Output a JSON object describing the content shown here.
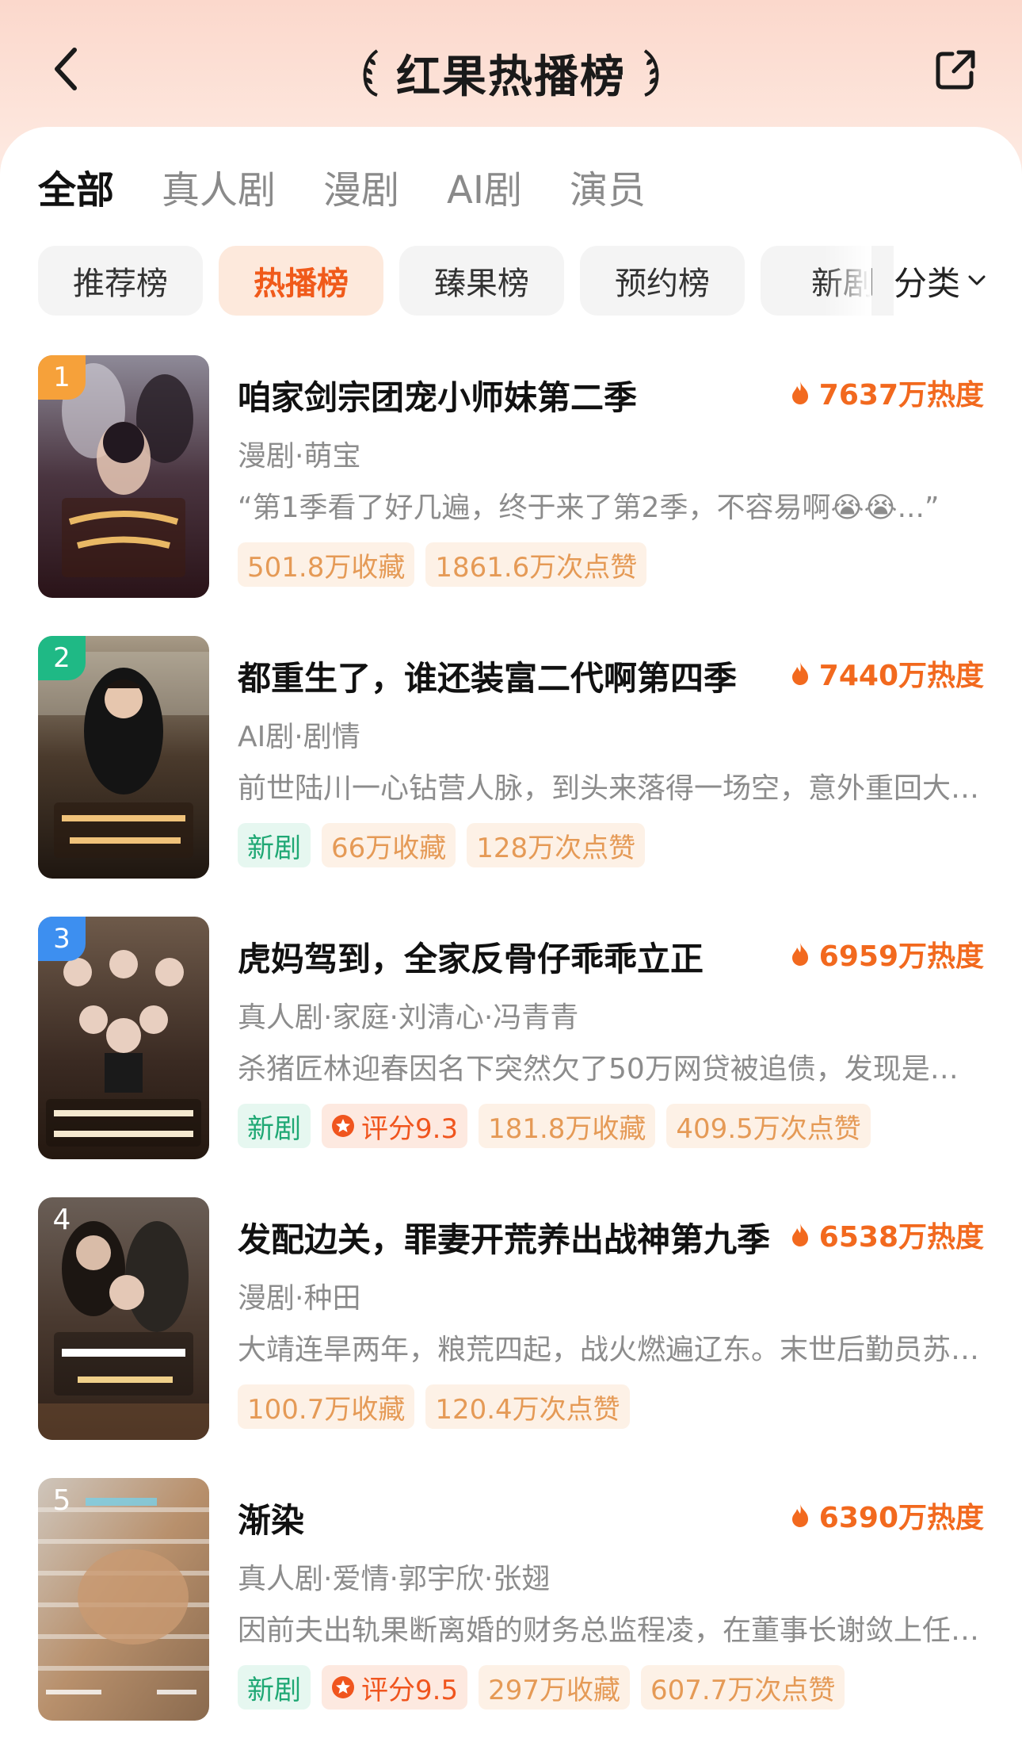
{
  "header": {
    "title": "红果热播榜"
  },
  "tabs": [
    {
      "label": "全部",
      "active": true
    },
    {
      "label": "真人剧",
      "active": false
    },
    {
      "label": "漫剧",
      "active": false
    },
    {
      "label": "AI剧",
      "active": false
    },
    {
      "label": "演员",
      "active": false
    }
  ],
  "chips": [
    {
      "label": "推荐榜",
      "active": false
    },
    {
      "label": "热播榜",
      "active": true
    },
    {
      "label": "臻果榜",
      "active": false
    },
    {
      "label": "预约榜",
      "active": false
    },
    {
      "label": "新剧",
      "active": false
    }
  ],
  "category": {
    "label": "分类"
  },
  "colors": {
    "accent": "#f05a1a",
    "heat": "#f2691e",
    "rank1": "#f6a13a",
    "rank2": "#1fb985",
    "rank3": "#3d8ff0",
    "tag_new": "#1fa874",
    "tag_default": "#e59a56"
  },
  "items": [
    {
      "rank": "1",
      "title": "咱家剑宗团宠小师妹第二季",
      "heat": "7637万热度",
      "meta": "漫剧·萌宝",
      "desc": "“第1季看了好几遍，终于来了第2季，不容易啊😭😭...”",
      "tags": [
        "501.8万收藏",
        "1861.6万次点赞"
      ],
      "cover_text": "咱家剑宗团宠小师妹第二季"
    },
    {
      "rank": "2",
      "title": "都重生了，谁还装富二代啊第四季",
      "heat": "7440万热度",
      "meta": "AI剧·剧情",
      "desc": "前世陆川一心钻营人脉，到头来落得一场空，意外重回大…",
      "tags": [
        "新剧",
        "66万收藏",
        "128万次点赞"
      ],
      "cover_text": "都重生了，谁还装富二代啊"
    },
    {
      "rank": "3",
      "title": "虎妈驾到，全家反骨仔乖乖立正",
      "heat": "6959万热度",
      "meta": "真人剧·家庭·刘清心·冯青青",
      "desc": "杀猪匠林迎春因名下突然欠了50万网贷被追债，发现是…",
      "tags": [
        "新剧",
        "评分9.3",
        "181.8万收藏",
        "409.5万次点赞"
      ],
      "cover_text": "虎妈驾到，全家反骨仔乖乖立正"
    },
    {
      "rank": "4",
      "title": "发配边关，罪妻开荒养出战神第九季",
      "heat": "6538万热度",
      "meta": "漫剧·种田",
      "desc": "大靖连旱两年，粮荒四起，战火燃遍辽东。末世后勤员苏…",
      "tags": [
        "100.7万收藏",
        "120.4万次点赞"
      ],
      "cover_text": "罪妻开荒养出战神"
    },
    {
      "rank": "5",
      "title": "渐染",
      "heat": "6390万热度",
      "meta": "真人剧·爱情·郭宇欣·张翅",
      "desc": "因前夫出轨果断离婚的财务总监程凌，在董事长谢敛上任…",
      "tags": [
        "新剧",
        "评分9.5",
        "297万收藏",
        "607.7万次点赞"
      ],
      "cover_text": "渐染"
    }
  ]
}
